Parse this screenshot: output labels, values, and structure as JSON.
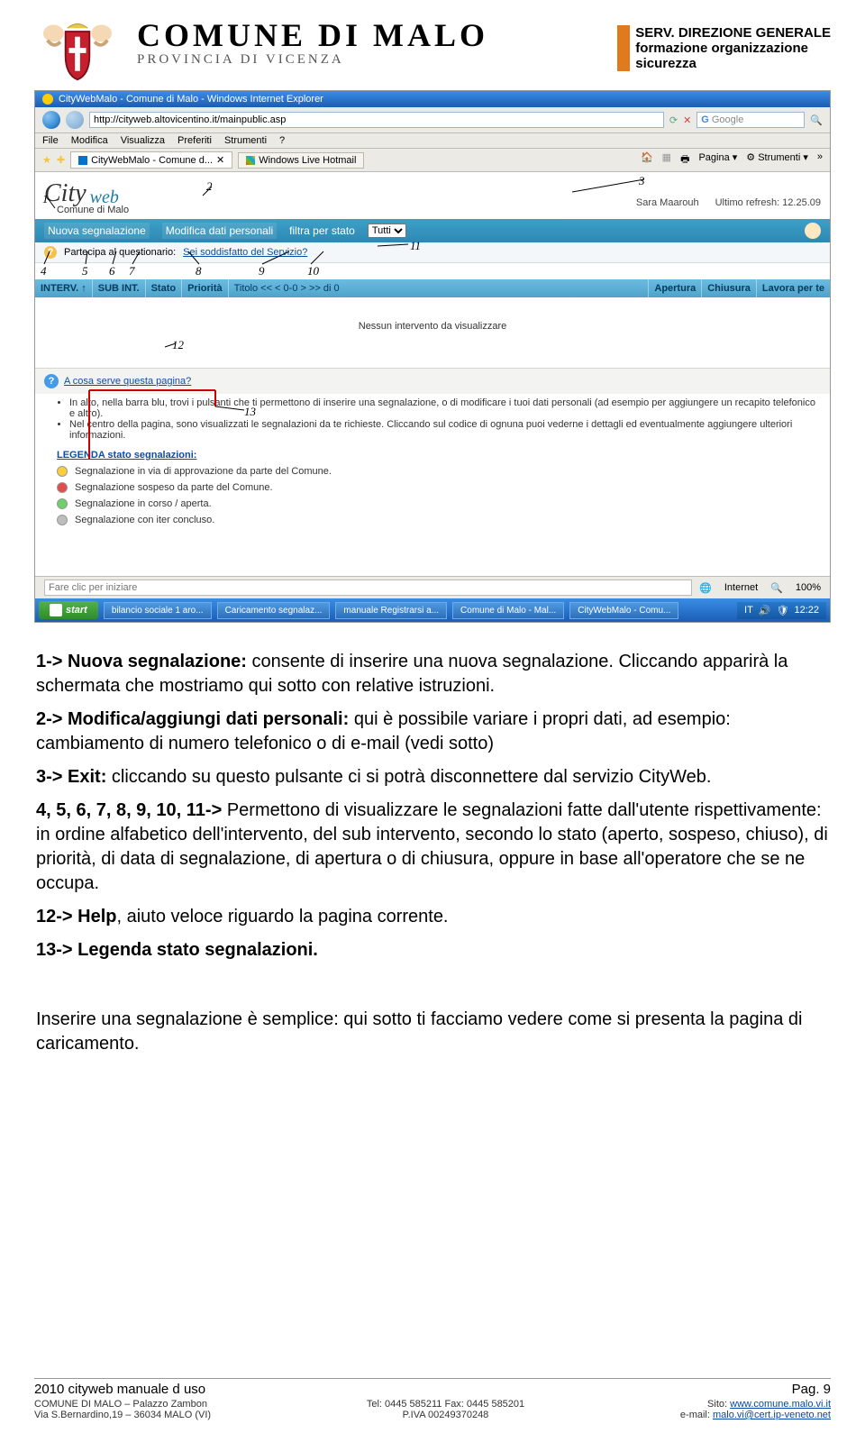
{
  "header": {
    "title": "COMUNE DI MALO",
    "subtitle": "PROVINCIA DI VICENZA",
    "dept1": "SERV. DIREZIONE GENERALE",
    "dept2": "formazione organizzazione",
    "dept3": "sicurezza"
  },
  "ie": {
    "title": "CityWebMalo - Comune di Malo - Windows Internet Explorer",
    "url": "http://cityweb.altovicentino.it/mainpublic.asp",
    "search_placeholder": "Google",
    "menu": [
      "File",
      "Modifica",
      "Visualizza",
      "Preferiti",
      "Strumenti",
      "?"
    ],
    "tabs": [
      "CityWebMalo - Comune d...",
      "Windows Live Hotmail"
    ],
    "tools": [
      "Pagina",
      "Strumenti"
    ],
    "status_placeholder": "Fare clic per iniziare",
    "status_net": "Internet",
    "status_zoom": "100%"
  },
  "cityweb": {
    "logo_city": "City",
    "logo_web": "web",
    "sub": "Comune di Malo",
    "user_name": "Sara Maarouh",
    "refresh": "Ultimo refresh: 12.25.09",
    "toolbar": {
      "new": "Nuova segnalazione",
      "edit": "Modifica dati personali",
      "filter_label": "filtra per stato",
      "filter_value": "Tutti"
    },
    "poll": {
      "label": "Partecipa al questionario:",
      "question": "Sei soddisfatto del Servizio?"
    },
    "columns": {
      "c1": "INTERV. ↑",
      "c2": "SUB INT.",
      "c3": "Stato",
      "c4": "Priorità",
      "c5": "Titolo << < 0-0 > >> di 0",
      "c6": "Apertura",
      "c7": "Chiusura",
      "c8": "Lavora per te"
    },
    "empty": "Nessun intervento da visualizzare",
    "help": {
      "link": "A cosa serve questa pagina?",
      "b1": "In alto, nella barra blu, trovi i pulsanti che ti permettono di inserire una segnalazione, o di modificare i tuoi dati personali (ad esempio per aggiungere un recapito telefonico e altro).",
      "b2": "Nel centro della pagina, sono visualizzati le segnalazioni da te richieste. Cliccando sul codice di ognuna puoi vederne i dettagli ed eventualmente aggiungere ulteriori informazioni.",
      "legend_title": "LEGENDA stato segnalazioni:",
      "l1": "Segnalazione in via di approvazione da parte del Comune.",
      "l2": "Segnalazione sospeso da parte del Comune.",
      "l3": "Segnalazione in corso / aperta.",
      "l4": "Segnalazione con iter concluso."
    }
  },
  "taskbar": {
    "start": "start",
    "items": [
      "bilancio sociale 1 aro...",
      "Caricamento segnalaz...",
      "manuale Registrarsi a...",
      "Comune di Malo - Mal...",
      "CityWebMalo - Comu..."
    ],
    "time": "12:22"
  },
  "callouts": {
    "n1": "1",
    "n2": "2",
    "n3": "3",
    "n4": "4",
    "n5": "5",
    "n6": "6",
    "n7": "7",
    "n8": "8",
    "n9": "9",
    "n10": "10",
    "n11": "11",
    "n12": "12",
    "n13": "13"
  },
  "body": {
    "p1a": "1-> Nuova segnalazione:",
    "p1b": " consente di inserire una nuova segnalazione. Cliccando apparirà la schermata che mostriamo qui sotto con relative istruzioni.",
    "p2a": "2-> Modifica/aggiungi dati personali:",
    "p2b": " qui è possibile variare i propri dati, ad esempio: cambiamento di numero telefonico o di e-mail (vedi sotto)",
    "p3a": "3-> Exit:",
    "p3b": " cliccando su questo pulsante ci si potrà disconnettere dal servizio CityWeb.",
    "p4a": "4, 5, 6, 7, 8, 9, 10, 11->",
    "p4b": " Permettono di visualizzare le segnalazioni fatte dall'utente rispettivamente: in ordine alfabetico dell'intervento, del sub intervento, secondo lo stato (aperto, sospeso, chiuso), di priorità, di data di segnalazione, di apertura o di chiusura, oppure in base all'operatore che se ne occupa.",
    "p12a": "12-> Help",
    "p12b": ", aiuto veloce riguardo la pagina corrente.",
    "p13a": "13-> Legenda stato segnalazioni.",
    "final": "Inserire una segnalazione è semplice: qui sotto ti facciamo vedere come si presenta la pagina di caricamento."
  },
  "footer": {
    "top_left": "2010 cityweb manuale d uso",
    "top_right": "Pag. 9",
    "col1a": "COMUNE DI MALO – Palazzo Zambon",
    "col1b": "Via S.Bernardino,19 – 36034 MALO (VI)",
    "col2a": "Tel: 0445 585211  Fax: 0445 585201",
    "col2b": "P.IVA 00249370248",
    "col3a_label": "Sito: ",
    "col3a_link": "www.comune.malo.vi.it",
    "col3b_label": "e-mail: ",
    "col3b_link": "malo.vi@cert.ip-veneto.net"
  }
}
